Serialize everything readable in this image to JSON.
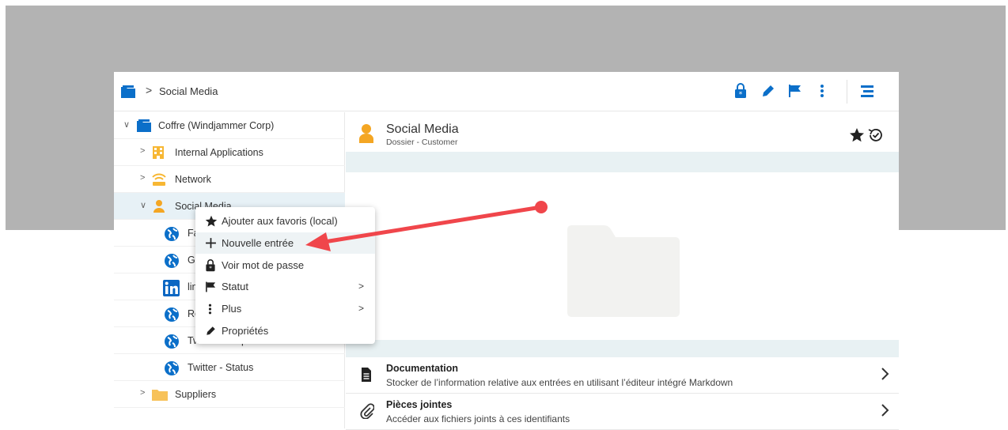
{
  "breadcrumb": {
    "label": "Social Media",
    "separator": ">"
  },
  "header_icons": [
    "lock-star-icon",
    "pencil-icon",
    "flag-icon",
    "more-vertical-icon",
    "list-tree-icon"
  ],
  "tree": {
    "root": "Coffre (Windjammer Corp)",
    "items": [
      {
        "label": "Internal Applications",
        "icon": "building-icon"
      },
      {
        "label": "Network",
        "icon": "network-icon"
      },
      {
        "label": "Social Media",
        "icon": "user-icon"
      },
      {
        "label": "Fa",
        "icon": "globe-icon"
      },
      {
        "label": "Go",
        "icon": "globe-icon"
      },
      {
        "label": "lin",
        "icon": "linkedin-icon"
      },
      {
        "label": "Re",
        "icon": "globe-icon"
      },
      {
        "label": "Twitter - Corporate",
        "icon": "globe-icon"
      },
      {
        "label": "Twitter - Status",
        "icon": "globe-icon"
      },
      {
        "label": "Suppliers",
        "icon": "folder-icon"
      }
    ],
    "social_media_visible_label": "Social Media"
  },
  "context_menu": {
    "items": [
      {
        "label": "Ajouter aux favoris (local)"
      },
      {
        "label": "Nouvelle entrée"
      },
      {
        "label": "Voir mot de passe"
      },
      {
        "label": "Statut"
      },
      {
        "label": "Plus"
      },
      {
        "label": "Propriétés"
      }
    ]
  },
  "entry": {
    "title": "Social Media",
    "subtitle": "Dossier - Customer"
  },
  "sections": [
    {
      "title": "Documentation",
      "desc": "Stocker de l’information relative aux entrées en utilisant l’éditeur intégré Markdown"
    },
    {
      "title": "Pièces jointes",
      "desc": "Accéder aux fichiers joints à ces identifiants"
    }
  ],
  "colors": {
    "accent": "#0b6fc9",
    "user_orange": "#f4a623",
    "folder_yellow": "#f7c25a",
    "annotation_red": "#f0464b"
  }
}
